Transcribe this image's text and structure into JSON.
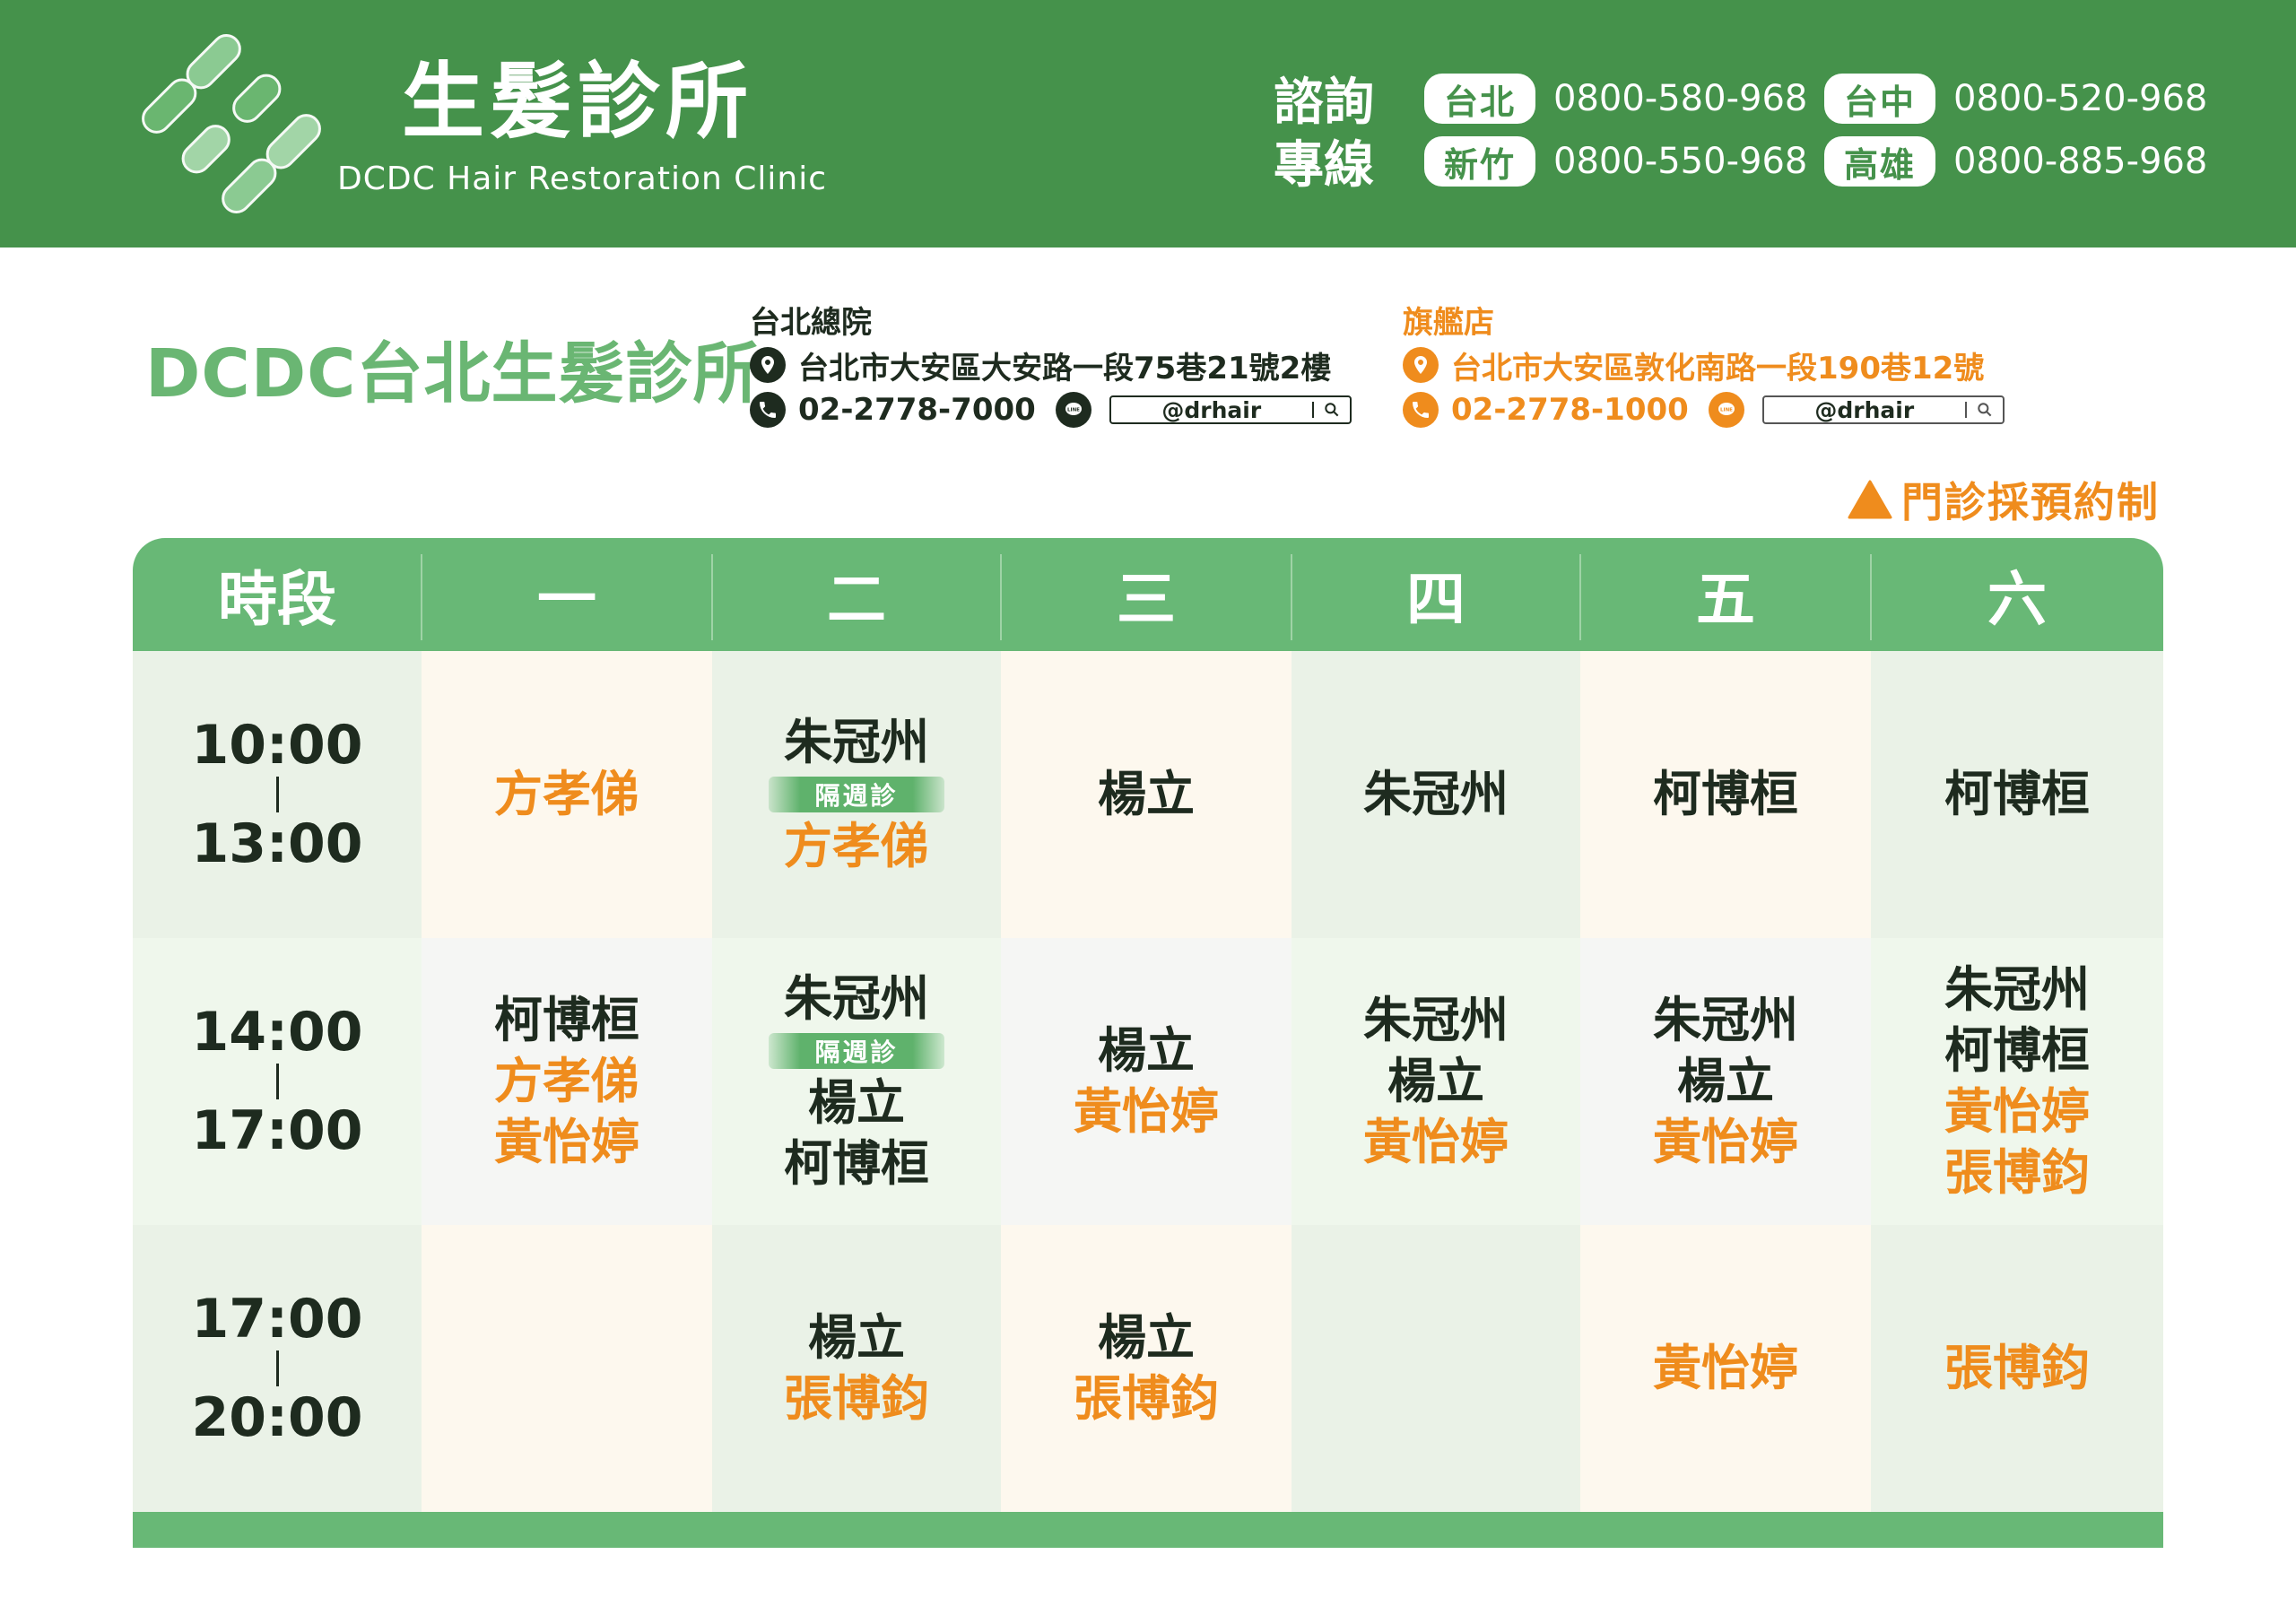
{
  "header": {
    "brand_title": "生髮診所",
    "brand_subtitle": "DCDC Hair Restoration Clinic",
    "hotline_label_line1": "諮詢",
    "hotline_label_line2": "專線",
    "hotlines": [
      {
        "city": "台北",
        "phone": "0800-580-968"
      },
      {
        "city": "台中",
        "phone": "0800-520-968"
      },
      {
        "city": "新竹",
        "phone": "0800-550-968"
      },
      {
        "city": "高雄",
        "phone": "0800-885-968"
      }
    ],
    "colors": {
      "band": "#45924b",
      "text": "#ffffff"
    }
  },
  "clinic": {
    "name": "DCDC台北生髮診所",
    "main_branch": {
      "title": "台北總院",
      "address": "台北市大安區大安路一段75巷21號2樓",
      "phone": "02-2778-7000",
      "line_id": "@drhair",
      "icons": [
        "location-pin-icon",
        "phone-icon",
        "line-icon",
        "search-icon"
      ]
    },
    "flagship_branch": {
      "title": "旗艦店",
      "address": "台北市大安區敦化南路一段190巷12號",
      "phone": "02-2778-1000",
      "line_id": "@drhair",
      "icons": [
        "location-pin-icon",
        "phone-icon",
        "line-icon",
        "search-icon"
      ]
    },
    "appointment_note": "門診採預約制",
    "colors": {
      "accent_green": "#6ab673",
      "accent_orange": "#ef8c1d",
      "dark": "#1e2b1f"
    }
  },
  "schedule": {
    "headers": [
      "時段",
      "一",
      "二",
      "三",
      "四",
      "五",
      "六"
    ],
    "alt_week_label": "隔週診",
    "rows": [
      {
        "time_start": "10:00",
        "time_sep": "|",
        "time_end": "13:00",
        "cells": [
          [
            {
              "name": "方孝俤",
              "color": "orange"
            }
          ],
          [
            {
              "name": "朱冠州",
              "color": "dark"
            },
            {
              "tag": "隔週診"
            },
            {
              "name": "方孝俤",
              "color": "orange"
            }
          ],
          [
            {
              "name": "楊立",
              "color": "dark"
            }
          ],
          [
            {
              "name": "朱冠州",
              "color": "dark"
            }
          ],
          [
            {
              "name": "柯博桓",
              "color": "dark"
            }
          ],
          [
            {
              "name": "柯博桓",
              "color": "dark"
            }
          ]
        ]
      },
      {
        "time_start": "14:00",
        "time_sep": "|",
        "time_end": "17:00",
        "cells": [
          [
            {
              "name": "柯博桓",
              "color": "dark"
            },
            {
              "name": "方孝俤",
              "color": "orange"
            },
            {
              "name": "黃怡婷",
              "color": "orange"
            }
          ],
          [
            {
              "name": "朱冠州",
              "color": "dark"
            },
            {
              "tag": "隔週診"
            },
            {
              "name": "楊立",
              "color": "dark"
            },
            {
              "name": "柯博桓",
              "color": "dark"
            }
          ],
          [
            {
              "name": "楊立",
              "color": "dark"
            },
            {
              "name": "黃怡婷",
              "color": "orange"
            }
          ],
          [
            {
              "name": "朱冠州",
              "color": "dark"
            },
            {
              "name": "楊立",
              "color": "dark"
            },
            {
              "name": "黃怡婷",
              "color": "orange"
            }
          ],
          [
            {
              "name": "朱冠州",
              "color": "dark"
            },
            {
              "name": "楊立",
              "color": "dark"
            },
            {
              "name": "黃怡婷",
              "color": "orange"
            }
          ],
          [
            {
              "name": "朱冠州",
              "color": "dark"
            },
            {
              "name": "柯博桓",
              "color": "dark"
            },
            {
              "name": "黃怡婷",
              "color": "orange"
            },
            {
              "name": "張博鈞",
              "color": "orange"
            }
          ]
        ]
      },
      {
        "time_start": "17:00",
        "time_sep": "|",
        "time_end": "20:00",
        "cells": [
          [],
          [
            {
              "name": "楊立",
              "color": "dark"
            },
            {
              "name": "張博鈞",
              "color": "orange"
            }
          ],
          [
            {
              "name": "楊立",
              "color": "dark"
            },
            {
              "name": "張博鈞",
              "color": "orange"
            }
          ],
          [],
          [
            {
              "name": "黃怡婷",
              "color": "orange"
            }
          ],
          [
            {
              "name": "張博鈞",
              "color": "orange"
            }
          ]
        ]
      }
    ],
    "colors": {
      "header": "#68b876",
      "cell_beige": "#fdf8ee",
      "cell_green": "#eaf2e7",
      "cell_light_gray": "#f5f6f4",
      "cell_light_green": "#eff7ec"
    }
  }
}
